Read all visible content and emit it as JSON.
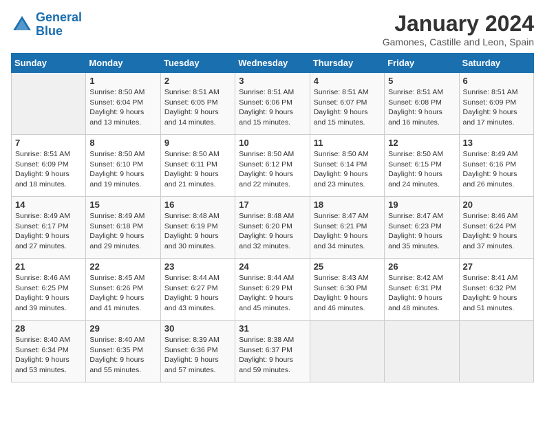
{
  "logo": {
    "line1": "General",
    "line2": "Blue"
  },
  "title": "January 2024",
  "subtitle": "Gamones, Castille and Leon, Spain",
  "days_of_week": [
    "Sunday",
    "Monday",
    "Tuesday",
    "Wednesday",
    "Thursday",
    "Friday",
    "Saturday"
  ],
  "weeks": [
    [
      {
        "day": "",
        "sunrise": "",
        "sunset": "",
        "daylight": ""
      },
      {
        "day": "1",
        "sunrise": "Sunrise: 8:50 AM",
        "sunset": "Sunset: 6:04 PM",
        "daylight": "Daylight: 9 hours and 13 minutes."
      },
      {
        "day": "2",
        "sunrise": "Sunrise: 8:51 AM",
        "sunset": "Sunset: 6:05 PM",
        "daylight": "Daylight: 9 hours and 14 minutes."
      },
      {
        "day": "3",
        "sunrise": "Sunrise: 8:51 AM",
        "sunset": "Sunset: 6:06 PM",
        "daylight": "Daylight: 9 hours and 15 minutes."
      },
      {
        "day": "4",
        "sunrise": "Sunrise: 8:51 AM",
        "sunset": "Sunset: 6:07 PM",
        "daylight": "Daylight: 9 hours and 15 minutes."
      },
      {
        "day": "5",
        "sunrise": "Sunrise: 8:51 AM",
        "sunset": "Sunset: 6:08 PM",
        "daylight": "Daylight: 9 hours and 16 minutes."
      },
      {
        "day": "6",
        "sunrise": "Sunrise: 8:51 AM",
        "sunset": "Sunset: 6:09 PM",
        "daylight": "Daylight: 9 hours and 17 minutes."
      }
    ],
    [
      {
        "day": "7",
        "sunrise": "Sunrise: 8:51 AM",
        "sunset": "Sunset: 6:09 PM",
        "daylight": "Daylight: 9 hours and 18 minutes."
      },
      {
        "day": "8",
        "sunrise": "Sunrise: 8:50 AM",
        "sunset": "Sunset: 6:10 PM",
        "daylight": "Daylight: 9 hours and 19 minutes."
      },
      {
        "day": "9",
        "sunrise": "Sunrise: 8:50 AM",
        "sunset": "Sunset: 6:11 PM",
        "daylight": "Daylight: 9 hours and 21 minutes."
      },
      {
        "day": "10",
        "sunrise": "Sunrise: 8:50 AM",
        "sunset": "Sunset: 6:12 PM",
        "daylight": "Daylight: 9 hours and 22 minutes."
      },
      {
        "day": "11",
        "sunrise": "Sunrise: 8:50 AM",
        "sunset": "Sunset: 6:14 PM",
        "daylight": "Daylight: 9 hours and 23 minutes."
      },
      {
        "day": "12",
        "sunrise": "Sunrise: 8:50 AM",
        "sunset": "Sunset: 6:15 PM",
        "daylight": "Daylight: 9 hours and 24 minutes."
      },
      {
        "day": "13",
        "sunrise": "Sunrise: 8:49 AM",
        "sunset": "Sunset: 6:16 PM",
        "daylight": "Daylight: 9 hours and 26 minutes."
      }
    ],
    [
      {
        "day": "14",
        "sunrise": "Sunrise: 8:49 AM",
        "sunset": "Sunset: 6:17 PM",
        "daylight": "Daylight: 9 hours and 27 minutes."
      },
      {
        "day": "15",
        "sunrise": "Sunrise: 8:49 AM",
        "sunset": "Sunset: 6:18 PM",
        "daylight": "Daylight: 9 hours and 29 minutes."
      },
      {
        "day": "16",
        "sunrise": "Sunrise: 8:48 AM",
        "sunset": "Sunset: 6:19 PM",
        "daylight": "Daylight: 9 hours and 30 minutes."
      },
      {
        "day": "17",
        "sunrise": "Sunrise: 8:48 AM",
        "sunset": "Sunset: 6:20 PM",
        "daylight": "Daylight: 9 hours and 32 minutes."
      },
      {
        "day": "18",
        "sunrise": "Sunrise: 8:47 AM",
        "sunset": "Sunset: 6:21 PM",
        "daylight": "Daylight: 9 hours and 34 minutes."
      },
      {
        "day": "19",
        "sunrise": "Sunrise: 8:47 AM",
        "sunset": "Sunset: 6:23 PM",
        "daylight": "Daylight: 9 hours and 35 minutes."
      },
      {
        "day": "20",
        "sunrise": "Sunrise: 8:46 AM",
        "sunset": "Sunset: 6:24 PM",
        "daylight": "Daylight: 9 hours and 37 minutes."
      }
    ],
    [
      {
        "day": "21",
        "sunrise": "Sunrise: 8:46 AM",
        "sunset": "Sunset: 6:25 PM",
        "daylight": "Daylight: 9 hours and 39 minutes."
      },
      {
        "day": "22",
        "sunrise": "Sunrise: 8:45 AM",
        "sunset": "Sunset: 6:26 PM",
        "daylight": "Daylight: 9 hours and 41 minutes."
      },
      {
        "day": "23",
        "sunrise": "Sunrise: 8:44 AM",
        "sunset": "Sunset: 6:27 PM",
        "daylight": "Daylight: 9 hours and 43 minutes."
      },
      {
        "day": "24",
        "sunrise": "Sunrise: 8:44 AM",
        "sunset": "Sunset: 6:29 PM",
        "daylight": "Daylight: 9 hours and 45 minutes."
      },
      {
        "day": "25",
        "sunrise": "Sunrise: 8:43 AM",
        "sunset": "Sunset: 6:30 PM",
        "daylight": "Daylight: 9 hours and 46 minutes."
      },
      {
        "day": "26",
        "sunrise": "Sunrise: 8:42 AM",
        "sunset": "Sunset: 6:31 PM",
        "daylight": "Daylight: 9 hours and 48 minutes."
      },
      {
        "day": "27",
        "sunrise": "Sunrise: 8:41 AM",
        "sunset": "Sunset: 6:32 PM",
        "daylight": "Daylight: 9 hours and 51 minutes."
      }
    ],
    [
      {
        "day": "28",
        "sunrise": "Sunrise: 8:40 AM",
        "sunset": "Sunset: 6:34 PM",
        "daylight": "Daylight: 9 hours and 53 minutes."
      },
      {
        "day": "29",
        "sunrise": "Sunrise: 8:40 AM",
        "sunset": "Sunset: 6:35 PM",
        "daylight": "Daylight: 9 hours and 55 minutes."
      },
      {
        "day": "30",
        "sunrise": "Sunrise: 8:39 AM",
        "sunset": "Sunset: 6:36 PM",
        "daylight": "Daylight: 9 hours and 57 minutes."
      },
      {
        "day": "31",
        "sunrise": "Sunrise: 8:38 AM",
        "sunset": "Sunset: 6:37 PM",
        "daylight": "Daylight: 9 hours and 59 minutes."
      },
      {
        "day": "",
        "sunrise": "",
        "sunset": "",
        "daylight": ""
      },
      {
        "day": "",
        "sunrise": "",
        "sunset": "",
        "daylight": ""
      },
      {
        "day": "",
        "sunrise": "",
        "sunset": "",
        "daylight": ""
      }
    ]
  ]
}
